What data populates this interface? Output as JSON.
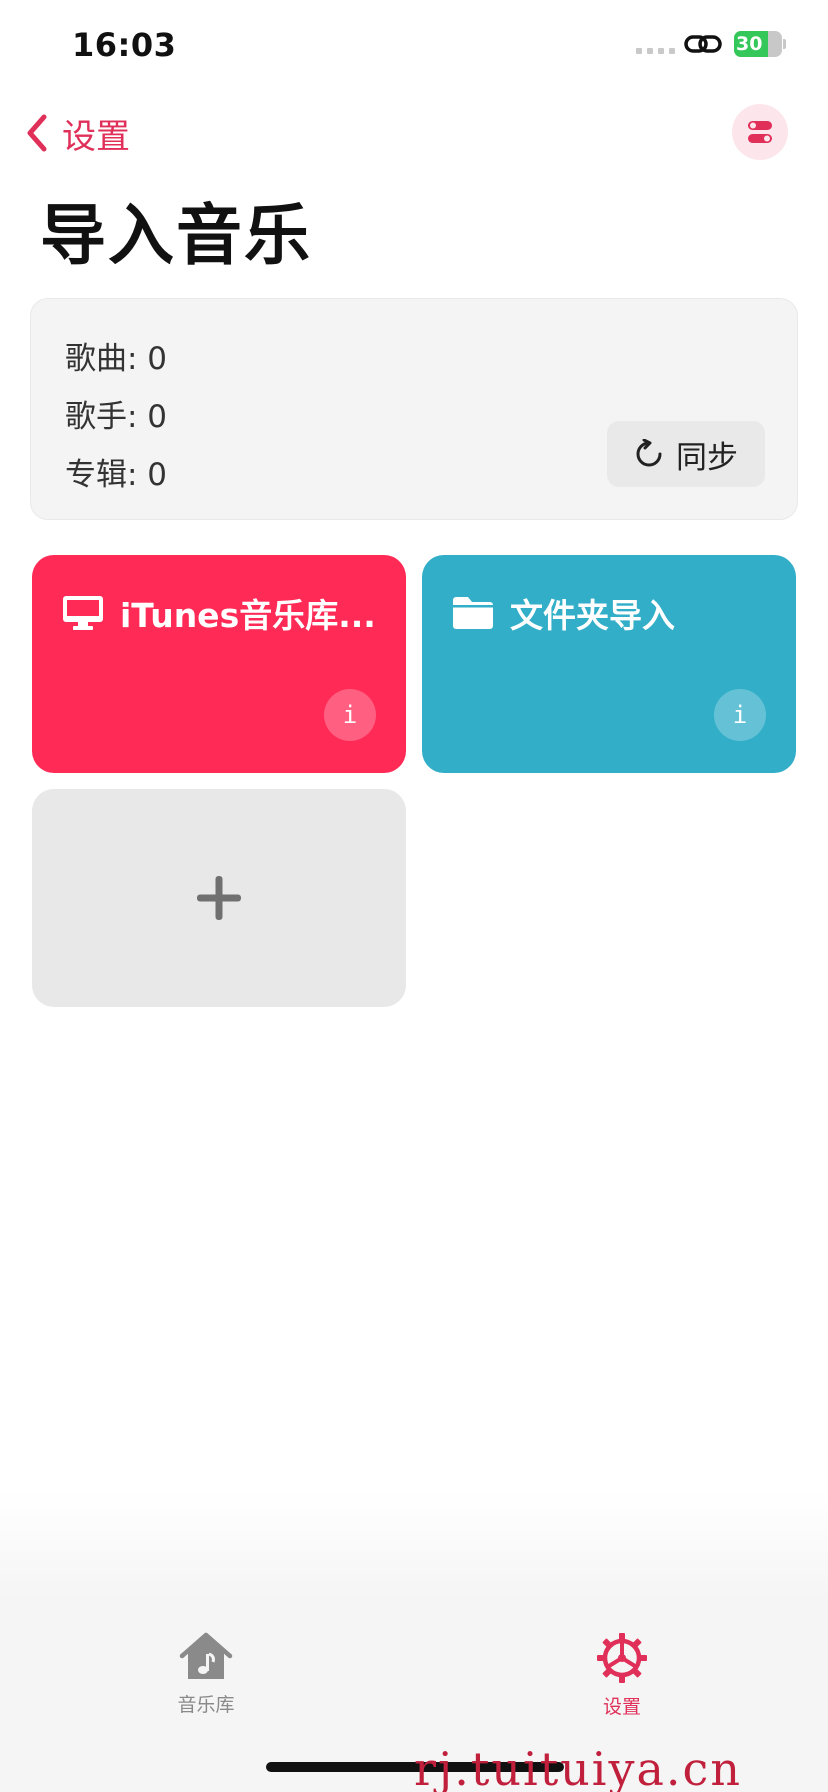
{
  "status_bar": {
    "time": "16:03",
    "battery_level": "30",
    "battery_fraction": 0.3,
    "icons": [
      "signal-dots-icon",
      "link-icon",
      "battery-charging-icon"
    ]
  },
  "nav": {
    "back_label": "设置",
    "back_icon": "chevron-left-icon",
    "toggle_icon": "toggle-switch-icon"
  },
  "page_title": "导入音乐",
  "stats": {
    "songs": "歌曲: 0",
    "artists": "歌手: 0",
    "albums": "专辑: 0",
    "sync_label": "同步",
    "sync_icon": "refresh-icon"
  },
  "sources": {
    "itunes": {
      "title": "iTunes音乐库...",
      "icon": "monitor-icon",
      "info": "i",
      "color": "#ff2a56"
    },
    "folder": {
      "title": "文件夹导入",
      "icon": "folder-icon",
      "info": "i",
      "color": "#32aec8"
    },
    "add_icon": "plus-icon"
  },
  "tab_bar": {
    "library_label": "音乐库",
    "library_icon": "home-music-icon",
    "settings_label": "设置",
    "settings_icon": "gear-icon",
    "active_color": "#e0305a",
    "inactive_color": "#8a8a8a"
  },
  "watermark": "rj.tuituiya.cn",
  "colors": {
    "accent": "#e0305a"
  }
}
